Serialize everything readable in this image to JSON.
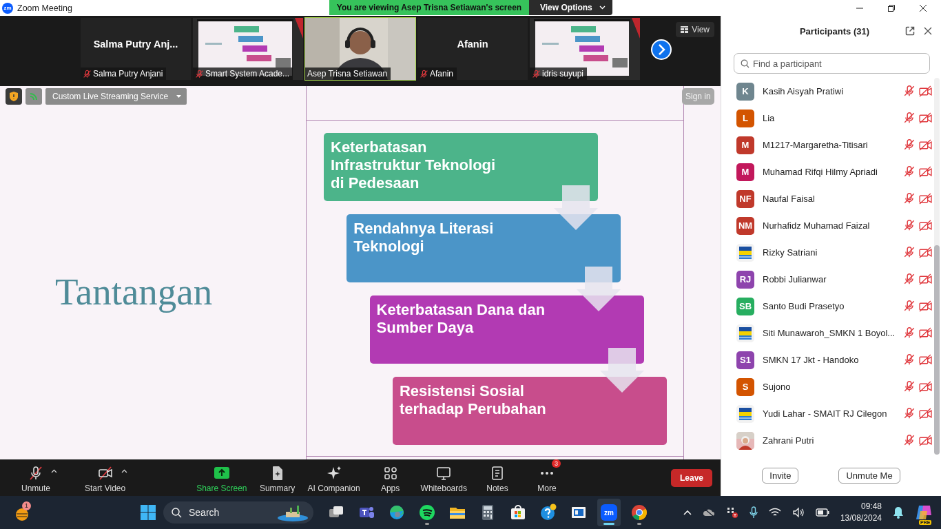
{
  "window": {
    "logo": "zm",
    "title": "Zoom Meeting"
  },
  "share_banner": {
    "text": "You are viewing Asep Trisna Setiawan's screen",
    "options_label": "View Options"
  },
  "video_strip": {
    "tiles": [
      {
        "kind": "name",
        "display_name": "Salma Putry Anj...",
        "label": "Salma Putry Anjani",
        "muted": true,
        "active": false
      },
      {
        "kind": "picture",
        "label": "Smart System Acade...",
        "muted": true,
        "active": false
      },
      {
        "kind": "picture",
        "label": "Asep Trisna Setiawan",
        "muted": false,
        "active": true
      },
      {
        "kind": "name",
        "display_name": "Afanin",
        "label": "Afanin",
        "muted": true,
        "active": false
      },
      {
        "kind": "picture",
        "label": "idris suyupi",
        "muted": true,
        "active": false
      }
    ],
    "view_label": "View"
  },
  "share_toolbar": {
    "stream_label": "Custom Live Streaming Service",
    "sign_in_label": "Sign in"
  },
  "slide": {
    "title": "Tantangan",
    "steps": [
      {
        "text": "Keterbatasan\nInfrastruktur Teknologi\ndi Pedesaan",
        "color": "#4cb48a"
      },
      {
        "text": "Rendahnya Literasi\nTeknologi",
        "color": "#4b95c8"
      },
      {
        "text": "Keterbatasan Dana dan\nSumber Daya",
        "color": "#b23ab3"
      },
      {
        "text": "Resistensi Sosial\nterhadap Perubahan",
        "color": "#c84d8c"
      }
    ]
  },
  "meeting_toolbar": {
    "items": [
      {
        "kind": "mic",
        "label": "Unmute",
        "off": true
      },
      {
        "kind": "video",
        "label": "Start Video",
        "off": true
      },
      {
        "kind": "share",
        "label": "Share Screen"
      },
      {
        "kind": "summary",
        "label": "Summary"
      },
      {
        "kind": "companion",
        "label": "AI Companion"
      },
      {
        "kind": "apps",
        "label": "Apps"
      },
      {
        "kind": "whiteboard",
        "label": "Whiteboards"
      },
      {
        "kind": "notes",
        "label": "Notes"
      },
      {
        "kind": "more",
        "label": "More",
        "badge": "3"
      }
    ],
    "leave_label": "Leave"
  },
  "participants": {
    "title": "Participants (31)",
    "search": {
      "placeholder": "Find a participant"
    },
    "list": [
      {
        "name": "Kasih Aisyah Pratiwi",
        "kind": "initials",
        "initials": "K",
        "color": "#6f868f",
        "muted": true,
        "video_off": true
      },
      {
        "name": "Lia",
        "kind": "initials",
        "initials": "L",
        "color": "#d35400",
        "muted": true,
        "video_off": true
      },
      {
        "name": "M1217-Margaretha-Titisari",
        "kind": "initials",
        "initials": "M",
        "color": "#c0392b",
        "muted": true,
        "video_off": true
      },
      {
        "name": "Muhamad Rifqi Hilmy Apriadi",
        "kind": "initials",
        "initials": "M",
        "color": "#c2185b",
        "muted": true,
        "video_off": true
      },
      {
        "name": "Naufal Faisal",
        "kind": "initials",
        "initials": "NF",
        "color": "#c0392b",
        "muted": true,
        "video_off": true
      },
      {
        "name": "Nurhafidz Muhamad Faizal",
        "kind": "initials",
        "initials": "NM",
        "color": "#c0392b",
        "muted": true,
        "video_off": true
      },
      {
        "name": "Rizky Satriani",
        "kind": "picture",
        "muted": true,
        "video_off": true
      },
      {
        "name": "Robbi Julianwar",
        "kind": "initials",
        "initials": "RJ",
        "color": "#8e44ad",
        "muted": true,
        "video_off": true
      },
      {
        "name": "Santo Budi Prasetyo",
        "kind": "initials",
        "initials": "SB",
        "color": "#27ae60",
        "muted": true,
        "video_off": true
      },
      {
        "name": "Siti Munawaroh_SMKN 1 Boyol...",
        "kind": "picture",
        "muted": true,
        "video_off": true
      },
      {
        "name": "SMKN 17 Jkt - Handoko",
        "kind": "initials",
        "initials": "S1",
        "color": "#8e44ad",
        "muted": true,
        "video_off": true
      },
      {
        "name": "Sujono",
        "kind": "initials",
        "initials": "S",
        "color": "#d35400",
        "muted": true,
        "video_off": true
      },
      {
        "name": "Yudi Lahar - SMAIT RJ Cilegon",
        "kind": "picture",
        "muted": true,
        "video_off": true
      },
      {
        "name": "Zahrani Putri",
        "kind": "picture",
        "muted": true,
        "video_off": true
      }
    ],
    "buttons": [
      "Invite",
      "Unmute Me"
    ]
  },
  "taskbar": {
    "weather_badge": "1",
    "search_label": "Search",
    "apps": [
      {
        "kind": "taskview",
        "running": false,
        "active": false
      },
      {
        "kind": "teams",
        "running": false,
        "active": false
      },
      {
        "kind": "edge",
        "running": false,
        "active": false
      },
      {
        "kind": "spotify",
        "running": true,
        "active": false
      },
      {
        "kind": "explorer",
        "running": false,
        "active": false
      },
      {
        "kind": "calculator",
        "running": false,
        "active": false
      },
      {
        "kind": "store",
        "running": false,
        "active": false
      },
      {
        "kind": "help",
        "running": false,
        "active": false
      },
      {
        "kind": "window",
        "running": false,
        "active": false
      },
      {
        "kind": "zoom",
        "running": true,
        "active": true,
        "label": "zm"
      },
      {
        "kind": "chrome",
        "running": true,
        "active": false
      }
    ],
    "time": "09:48",
    "date": "13/08/2024",
    "copilot_badge": "PRE"
  }
}
